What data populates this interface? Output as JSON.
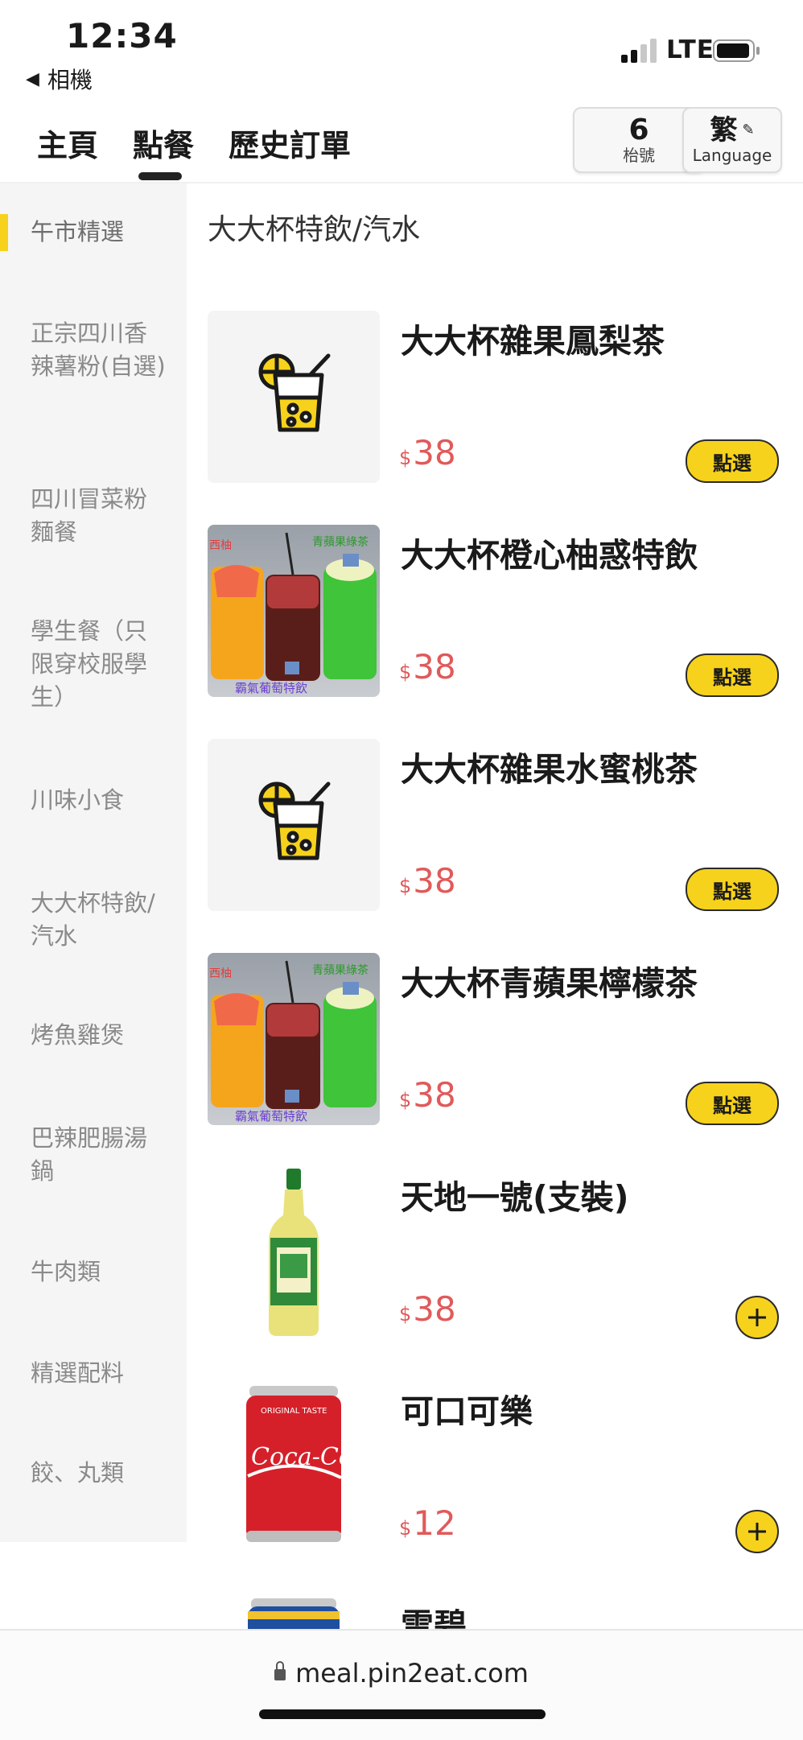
{
  "status_bar": {
    "time": "12:34",
    "back_app": "相機",
    "network": "LTE"
  },
  "nav": {
    "tabs": [
      {
        "label": "主頁"
      },
      {
        "label": "點餐"
      },
      {
        "label": "歷史訂單"
      }
    ],
    "active_tab": "點餐",
    "table": {
      "number": "6",
      "label": "枱號"
    },
    "language": {
      "current": "繁",
      "label": "Language"
    }
  },
  "sidebar": {
    "active_index": 0,
    "items": [
      {
        "label": "午市精選"
      },
      {
        "label": "正宗四川香辣薯粉(自選)"
      },
      {
        "label": "四川冒菜粉麵餐"
      },
      {
        "label": "學生餐（只限穿校服學生）"
      },
      {
        "label": "川味小食"
      },
      {
        "label": "大大杯特飲/汽水"
      },
      {
        "label": "烤魚雞煲"
      },
      {
        "label": "巴辣肥腸湯鍋"
      },
      {
        "label": "牛肉類"
      },
      {
        "label": "精選配料"
      },
      {
        "label": "餃、丸類"
      }
    ]
  },
  "section": {
    "title": "大大杯特飲/汽水"
  },
  "currency_symbol": "$",
  "choose_label": "點選",
  "items": [
    {
      "name": "大大杯雜果鳳梨茶",
      "price": "38",
      "action": "choose",
      "image": "drink-placeholder-icon"
    },
    {
      "name": "大大杯橙心柚惑特飲",
      "price": "38",
      "action": "choose",
      "image": "three-drinks-photo",
      "photo_text_top": "青蘋果綠茶",
      "photo_text_bottom": "霸氣葡萄特飲",
      "photo_text_left": "西柚"
    },
    {
      "name": "大大杯雜果水蜜桃茶",
      "price": "38",
      "action": "choose",
      "image": "drink-placeholder-icon"
    },
    {
      "name": "大大杯青蘋果檸檬茶",
      "price": "38",
      "action": "choose",
      "image": "three-drinks-photo",
      "photo_text_top": "青蘋果綠茶",
      "photo_text_bottom": "霸氣葡萄特飲",
      "photo_text_left": "西柚"
    },
    {
      "name": "天地一號(支裝)",
      "price": "38",
      "action": "add",
      "image": "vinegar-bottle-photo"
    },
    {
      "name": "可口可樂",
      "price": "12",
      "action": "add",
      "image": "coke-can-photo",
      "photo_text_top": "ORIGINAL TASTE",
      "photo_text_logo": "Coca-Cola"
    },
    {
      "name": "雪碧",
      "price": "",
      "action": "none",
      "image": "sprite-can-photo"
    }
  ],
  "url_bar": {
    "url": "meal.pin2eat.com"
  },
  "colors": {
    "accent_yellow": "#f7d21c",
    "price_red": "#e05a5a",
    "sidebar_bg": "#f5f5f5"
  }
}
